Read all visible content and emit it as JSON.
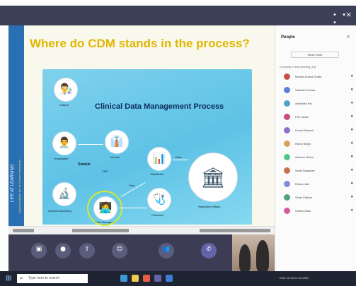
{
  "window": {
    "controls_label": "• • •",
    "close_label": "×"
  },
  "slide": {
    "title": "Where do CDM stands in the process?",
    "side_text": "LIFE AT LEARNING",
    "side_subtext": "Learning Solutions for Life Science Professionals",
    "watermark": "Ai"
  },
  "diagram": {
    "title": "Clinical Data Management Process",
    "nodes": [
      {
        "label": "Subject",
        "glyph": "👨‍🔬"
      },
      {
        "label": "Investigator",
        "glyph": "👨‍⚕️"
      },
      {
        "label": "Monitor",
        "glyph": "👔"
      },
      {
        "label": "Sample",
        "glyph": ""
      },
      {
        "label": "Central Laboratory",
        "glyph": "🔬"
      },
      {
        "label": "Data Manager",
        "glyph": "🧑‍💻"
      },
      {
        "label": "Statistician",
        "glyph": "📊"
      },
      {
        "label": "Clinicians",
        "glyph": "🩺"
      },
      {
        "label": "Regulatory Affairs",
        "glyph": "🏛"
      }
    ],
    "arrow_labels": [
      "CRF",
      "Data",
      "Data"
    ]
  },
  "meeting": {
    "controls": [
      {
        "name": "camera",
        "glyph": "▣"
      },
      {
        "name": "microphone",
        "glyph": "●"
      },
      {
        "name": "share",
        "glyph": "⇪"
      },
      {
        "name": "reactions",
        "glyph": "☺"
      },
      {
        "name": "participants",
        "glyph": "👥"
      },
      {
        "name": "hang-up",
        "glyph": "✆"
      }
    ]
  },
  "people": {
    "title": "People",
    "share_label": "Share invite",
    "section_label": "Currently in this meeting (14)",
    "participants": [
      {
        "name": "Manish Anand Gupta",
        "color": "#c94f4f"
      },
      {
        "name": "Vaishali Kshirsa",
        "color": "#5c7fd6"
      },
      {
        "name": "Abhishek Pal",
        "color": "#4fa3c9"
      },
      {
        "name": "Priti Yadav",
        "color": "#c94f7e"
      },
      {
        "name": "Komal Sawant",
        "color": "#8e6fc9"
      },
      {
        "name": "Rahul Singh",
        "color": "#d6a35c"
      },
      {
        "name": "Abhinav Sinha",
        "color": "#4fc98a"
      },
      {
        "name": "Swati Sangwan",
        "color": "#c96f4f"
      },
      {
        "name": "Rohan Jain",
        "color": "#7f8ed6"
      },
      {
        "name": "Vihan Pathak",
        "color": "#4fa37f"
      },
      {
        "name": "Sneha Joshi",
        "color": "#d65c9e"
      }
    ]
  },
  "taskbar": {
    "search_placeholder": "Type here to search",
    "tray_text": "ENG  12:45  21-04-2022"
  }
}
